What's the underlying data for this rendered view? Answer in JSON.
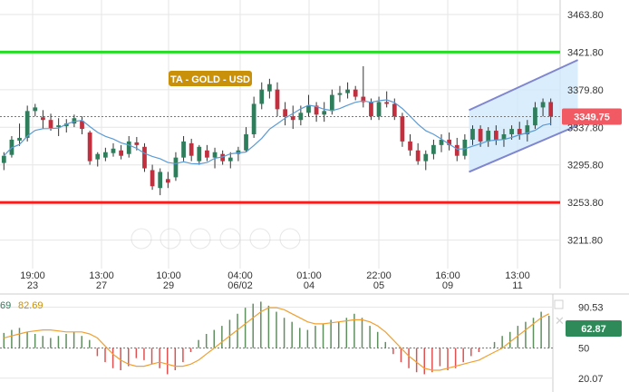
{
  "colors": {
    "bull": "#2e7d5b",
    "bear": "#c0303f",
    "ma_line": "#5b9bd5",
    "support": "#ff1a1a",
    "resistance": "#22dd22",
    "channel_fill": "#cfe8fb",
    "channel_edge": "#7f86cf",
    "badge": "#c9900a",
    "price_tag": "#f25a63",
    "rsi_tag": "#2f8a5a",
    "osc_line": "#f0a030",
    "osc_up": "#5f8f5f",
    "osc_down": "#e05050",
    "grid": "#e6e6e6",
    "dotted": "#777777"
  },
  "chart_data": [
    {
      "type": "candlestick",
      "title": "TA - GOLD - USD",
      "y_ticks": [
        "3463.80",
        "3421.80",
        "3379.80",
        "3337.80",
        "3295.80",
        "3253.80",
        "3211.80"
      ],
      "ylim": [
        3180,
        3480
      ],
      "x_ticks": [
        {
          "time": "19:00",
          "date": "23"
        },
        {
          "time": "13:00",
          "date": "27"
        },
        {
          "time": "10:00",
          "date": "29"
        },
        {
          "time": "04:00",
          "date": "06/02"
        },
        {
          "time": "01:00",
          "date": "04"
        },
        {
          "time": "22:00",
          "date": "05"
        },
        {
          "time": "16:00",
          "date": "09"
        },
        {
          "time": "13:00",
          "date": "11"
        }
      ],
      "last_price": "3349.75",
      "last_price_value": 3349.75,
      "resistance": 3421.8,
      "support": 3253.8,
      "channel": {
        "upper_start_idx": 60,
        "upper_start": 3357,
        "upper_end_idx": 73,
        "upper_end": 3413,
        "lower_start_idx": 60,
        "lower_start": 3288,
        "lower_end_idx": 73,
        "lower_end": 3340
      },
      "candles": [
        [
          3298,
          3310,
          3290,
          3306
        ],
        [
          3307,
          3328,
          3304,
          3324
        ],
        [
          3323,
          3342,
          3317,
          3326
        ],
        [
          3326,
          3362,
          3322,
          3356
        ],
        [
          3356,
          3364,
          3350,
          3360
        ],
        [
          3349,
          3357,
          3336,
          3346
        ],
        [
          3346,
          3353,
          3334,
          3337
        ],
        [
          3338,
          3348,
          3328,
          3340
        ],
        [
          3339,
          3347,
          3332,
          3342
        ],
        [
          3342,
          3352,
          3338,
          3348
        ],
        [
          3345,
          3350,
          3330,
          3336
        ],
        [
          3332,
          3334,
          3296,
          3300
        ],
        [
          3302,
          3310,
          3294,
          3308
        ],
        [
          3304,
          3315,
          3300,
          3310
        ],
        [
          3309,
          3320,
          3305,
          3314
        ],
        [
          3312,
          3318,
          3302,
          3306
        ],
        [
          3308,
          3328,
          3304,
          3322
        ],
        [
          3321,
          3327,
          3312,
          3318
        ],
        [
          3316,
          3320,
          3288,
          3292
        ],
        [
          3290,
          3296,
          3268,
          3272
        ],
        [
          3270,
          3292,
          3262,
          3288
        ],
        [
          3280,
          3288,
          3270,
          3276
        ],
        [
          3282,
          3310,
          3278,
          3304
        ],
        [
          3304,
          3328,
          3300,
          3322
        ],
        [
          3320,
          3325,
          3300,
          3306
        ],
        [
          3300,
          3318,
          3296,
          3316
        ],
        [
          3312,
          3318,
          3300,
          3304
        ],
        [
          3304,
          3315,
          3292,
          3310
        ],
        [
          3308,
          3312,
          3296,
          3300
        ],
        [
          3300,
          3310,
          3292,
          3304
        ],
        [
          3308,
          3316,
          3300,
          3312
        ],
        [
          3312,
          3338,
          3310,
          3330
        ],
        [
          3330,
          3372,
          3326,
          3364
        ],
        [
          3364,
          3388,
          3358,
          3380
        ],
        [
          3378,
          3392,
          3370,
          3386
        ],
        [
          3380,
          3388,
          3350,
          3358
        ],
        [
          3358,
          3366,
          3340,
          3350
        ],
        [
          3350,
          3362,
          3336,
          3346
        ],
        [
          3346,
          3362,
          3340,
          3354
        ],
        [
          3354,
          3374,
          3350,
          3362
        ],
        [
          3362,
          3366,
          3344,
          3352
        ],
        [
          3352,
          3366,
          3344,
          3356
        ],
        [
          3356,
          3380,
          3352,
          3374
        ],
        [
          3374,
          3384,
          3366,
          3376
        ],
        [
          3376,
          3388,
          3370,
          3380
        ],
        [
          3380,
          3384,
          3368,
          3372
        ],
        [
          3372,
          3406,
          3360,
          3366
        ],
        [
          3366,
          3370,
          3346,
          3350
        ],
        [
          3350,
          3372,
          3346,
          3366
        ],
        [
          3366,
          3378,
          3360,
          3364
        ],
        [
          3364,
          3370,
          3346,
          3350
        ],
        [
          3350,
          3354,
          3316,
          3322
        ],
        [
          3322,
          3330,
          3306,
          3312
        ],
        [
          3312,
          3320,
          3296,
          3300
        ],
        [
          3300,
          3312,
          3290,
          3308
        ],
        [
          3308,
          3324,
          3302,
          3318
        ],
        [
          3318,
          3330,
          3310,
          3324
        ],
        [
          3324,
          3332,
          3312,
          3318
        ],
        [
          3318,
          3326,
          3300,
          3306
        ],
        [
          3306,
          3330,
          3302,
          3324
        ],
        [
          3324,
          3340,
          3318,
          3336
        ],
        [
          3336,
          3340,
          3316,
          3322
        ],
        [
          3322,
          3338,
          3316,
          3334
        ],
        [
          3334,
          3340,
          3318,
          3324
        ],
        [
          3324,
          3336,
          3316,
          3330
        ],
        [
          3330,
          3340,
          3324,
          3336
        ],
        [
          3336,
          3344,
          3324,
          3330
        ],
        [
          3330,
          3346,
          3322,
          3340
        ],
        [
          3340,
          3366,
          3336,
          3360
        ],
        [
          3360,
          3370,
          3350,
          3366
        ],
        [
          3366,
          3370,
          3340,
          3350
        ]
      ]
    },
    {
      "type": "indicator",
      "y_ticks": [
        "90.53",
        "50",
        "20.07"
      ],
      "ylim": [
        10,
        100
      ],
      "osc_value_left": "69",
      "line_value_left": "82.69",
      "current_value": "62.87",
      "histogram": [
        65,
        68,
        70,
        66,
        64,
        62,
        60,
        62,
        64,
        66,
        62,
        58,
        42,
        36,
        30,
        28,
        32,
        40,
        38,
        34,
        30,
        24,
        28,
        36,
        46,
        58,
        64,
        68,
        72,
        78,
        84,
        90,
        94,
        96,
        92,
        86,
        80,
        76,
        70,
        68,
        72,
        74,
        78,
        76,
        80,
        84,
        80,
        72,
        66,
        56,
        44,
        36,
        30,
        26,
        24,
        26,
        32,
        28,
        30,
        36,
        42,
        46,
        50,
        56,
        62,
        66,
        72,
        76,
        80,
        86,
        82
      ],
      "line": [
        60,
        62,
        64,
        66,
        67,
        68,
        68,
        67,
        66,
        66,
        66,
        64,
        60,
        52,
        44,
        38,
        34,
        32,
        32,
        34,
        36,
        34,
        32,
        32,
        34,
        38,
        44,
        50,
        56,
        62,
        68,
        74,
        80,
        86,
        90,
        90,
        88,
        84,
        80,
        76,
        74,
        74,
        75,
        76,
        77,
        78,
        78,
        76,
        72,
        66,
        58,
        50,
        42,
        36,
        30,
        28,
        28,
        30,
        32,
        34,
        36,
        38,
        42,
        46,
        50,
        56,
        62,
        68,
        74,
        80,
        84
      ]
    }
  ]
}
